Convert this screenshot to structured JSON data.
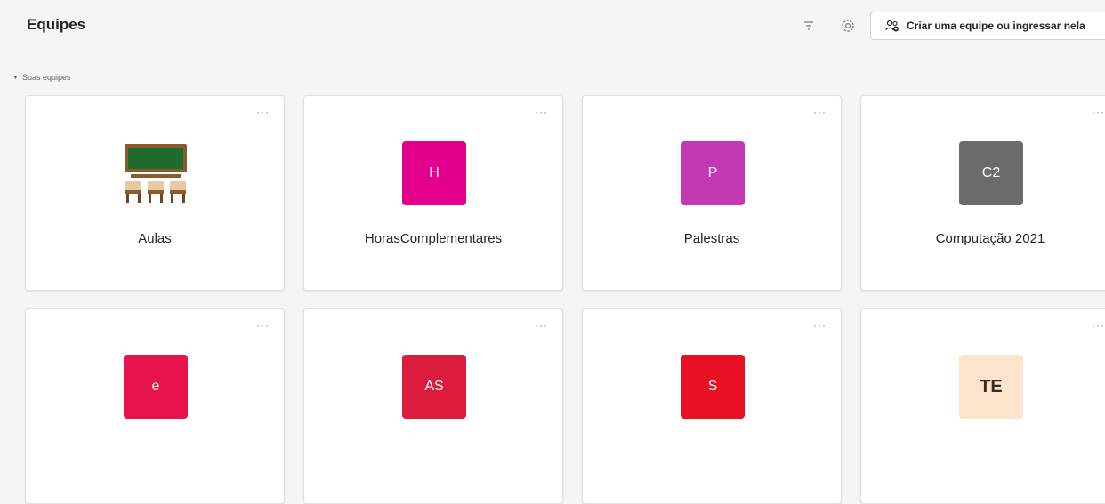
{
  "header": {
    "title": "Equipes",
    "create_button_label": "Criar uma equipe ou ingressar nela",
    "filter_icon": "filter-icon",
    "settings_icon": "settings-gear-icon",
    "create_icon": "people-add-icon"
  },
  "section": {
    "label": "Suas equipes",
    "expanded": true
  },
  "teams": [
    {
      "name": "Aulas",
      "avatar_type": "image",
      "image": "classroom-icon",
      "more": "···"
    },
    {
      "name": "HorasComplementares",
      "initials": "H",
      "color": "#e3008c",
      "more": "···"
    },
    {
      "name": "Palestras",
      "initials": "P",
      "color": "#c239b3",
      "more": "···"
    },
    {
      "name": "Computação 2021",
      "initials": "C2",
      "color": "#6b6b6b",
      "more": "···"
    },
    {
      "name": "",
      "initials": "e",
      "color": "#e8124c",
      "more": "···"
    },
    {
      "name": "",
      "initials": "AS",
      "color": "#dc1c3c",
      "more": "···"
    },
    {
      "name": "",
      "initials": "S",
      "color": "#e81123",
      "more": "···"
    },
    {
      "name": "",
      "initials": "TE",
      "color": "#fbe3cc",
      "text_color": "#3a2a1a",
      "more": "···"
    }
  ]
}
